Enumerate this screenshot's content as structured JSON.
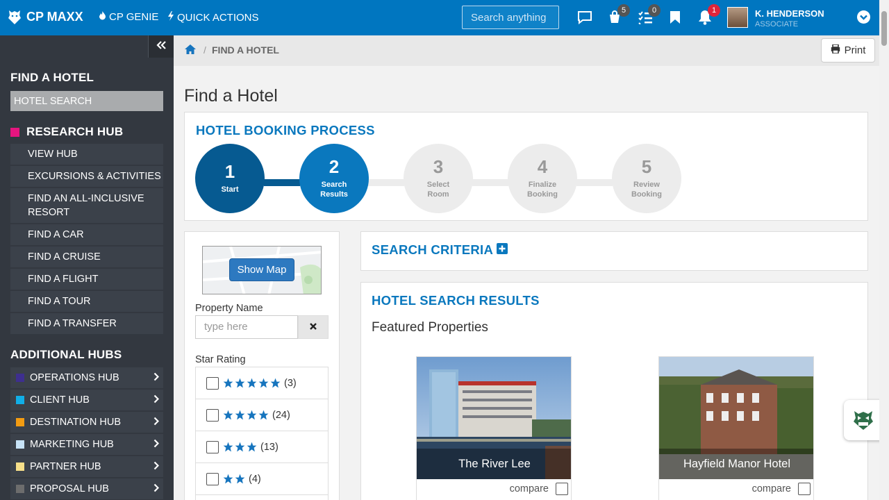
{
  "app": {
    "brand": "CP MAXX",
    "nav": [
      {
        "label": "CP GENIE",
        "icon": "flame-icon"
      },
      {
        "label": "QUICK ACTIONS",
        "icon": "bolt-icon"
      }
    ],
    "search_placeholder": "Search anything",
    "badges": {
      "cart": "5",
      "tasks": "0",
      "notifications": "1"
    },
    "user": {
      "name": "K. HENDERSON",
      "role": "ASSOCIATE"
    }
  },
  "sidebar": {
    "section1_title": "FIND A HOTEL",
    "section1_items": [
      "HOTEL SEARCH"
    ],
    "research_hub": {
      "title": "RESEARCH HUB",
      "color": "#e6157f",
      "items": [
        "VIEW HUB",
        "EXCURSIONS & ACTIVITIES",
        "FIND AN ALL-INCLUSIVE RESORT",
        "FIND A CAR",
        "FIND A CRUISE",
        "FIND A FLIGHT",
        "FIND A TOUR",
        "FIND A TRANSFER"
      ]
    },
    "additional_title": "ADDITIONAL HUBS",
    "hubs": [
      {
        "label": "OPERATIONS HUB",
        "color": "#3e2f8f"
      },
      {
        "label": "CLIENT HUB",
        "color": "#11aee8"
      },
      {
        "label": "DESTINATION HUB",
        "color": "#f39c12"
      },
      {
        "label": "MARKETING HUB",
        "color": "#c7e3f7"
      },
      {
        "label": "PARTNER HUB",
        "color": "#f7e08a"
      },
      {
        "label": "PROPOSAL HUB",
        "color": "#6d6d6d"
      }
    ]
  },
  "breadcrumb": {
    "current": "FIND A HOTEL",
    "print_label": "Print"
  },
  "page": {
    "title": "Find a Hotel"
  },
  "booking": {
    "title": "HOTEL BOOKING PROCESS",
    "steps": [
      {
        "num": "1",
        "label": "Start",
        "state": "done"
      },
      {
        "num": "2",
        "label": "Search Results",
        "state": "current"
      },
      {
        "num": "3",
        "label": "Select Room",
        "state": "todo"
      },
      {
        "num": "4",
        "label": "Finalize Booking",
        "state": "todo"
      },
      {
        "num": "5",
        "label": "Review Booking",
        "state": "todo"
      }
    ]
  },
  "filters": {
    "show_map_label": "Show Map",
    "property_name_label": "Property Name",
    "property_name_placeholder": "type here",
    "star_rating_label": "Star Rating",
    "star_options": [
      {
        "stars": 5,
        "count": "(3)"
      },
      {
        "stars": 4,
        "count": "(24)"
      },
      {
        "stars": 3,
        "count": "(13)"
      },
      {
        "stars": 2,
        "count": "(4)"
      }
    ]
  },
  "search_criteria": {
    "title": "SEARCH CRITERIA"
  },
  "results": {
    "title": "HOTEL SEARCH RESULTS",
    "featured_label": "Featured Properties",
    "compare_label": "compare",
    "hotels": [
      {
        "name": "The River Lee"
      },
      {
        "name": "Hayfield Manor Hotel"
      }
    ]
  }
}
